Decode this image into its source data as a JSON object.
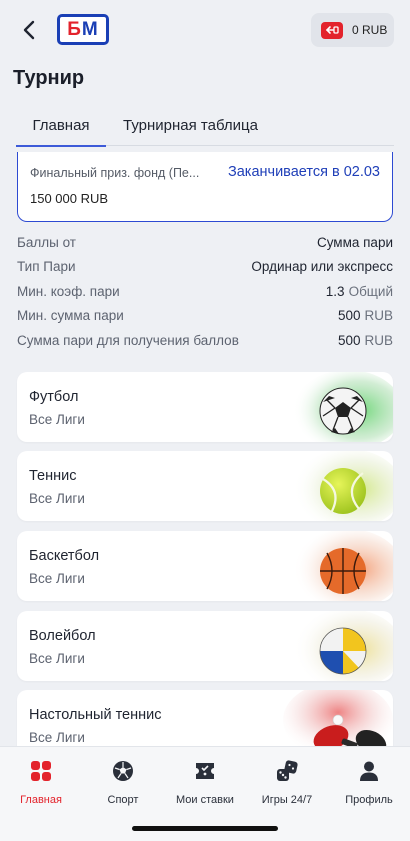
{
  "header": {
    "logo_left": "Б",
    "logo_right": "М",
    "balance": "0 RUB"
  },
  "page": {
    "title": "Турнир"
  },
  "tabs": [
    {
      "label": "Главная",
      "active": true
    },
    {
      "label": "Турнирная таблица",
      "active": false
    }
  ],
  "prize": {
    "label": "Финальный приз. фонд (Пе...",
    "ends": "Заканчивается в 02.03",
    "value": "150 000 RUB"
  },
  "info": [
    {
      "label": "Баллы от",
      "value": "Сумма пари",
      "unit": ""
    },
    {
      "label": "Тип Пари",
      "value": "Ординар или экспресс",
      "unit": ""
    },
    {
      "label": "Мин. коэф. пари",
      "value": "1.3",
      "unit": "Общий"
    },
    {
      "label": "Мин. сумма пари",
      "value": "500",
      "unit": "RUB"
    },
    {
      "label": "Сумма пари для получения баллов",
      "value": "500",
      "unit": "RUB"
    }
  ],
  "sports": [
    {
      "name": "Футбол",
      "sub": "Все Лиги",
      "icon": "soccer-ball-icon"
    },
    {
      "name": "Теннис",
      "sub": "Все Лиги",
      "icon": "tennis-ball-icon"
    },
    {
      "name": "Баскетбол",
      "sub": "Все Лиги",
      "icon": "basketball-icon"
    },
    {
      "name": "Волейбол",
      "sub": "Все Лиги",
      "icon": "volleyball-icon"
    },
    {
      "name": "Настольный теннис",
      "sub": "Все Лиги",
      "icon": "table-tennis-icon"
    }
  ],
  "nav": [
    {
      "label": "Главная",
      "icon": "home-grid-icon",
      "active": true
    },
    {
      "label": "Спорт",
      "icon": "sport-ball-icon",
      "active": false
    },
    {
      "label": "Мои ставки",
      "icon": "ticket-icon",
      "active": false
    },
    {
      "label": "Игры 24/7",
      "icon": "dice-icon",
      "active": false
    },
    {
      "label": "Профиль",
      "icon": "profile-icon",
      "active": false
    }
  ],
  "colors": {
    "accent": "#e3232c",
    "brand_blue": "#1a3fb5",
    "tab_underline": "#3d5ad8",
    "background": "#eef0f4"
  }
}
